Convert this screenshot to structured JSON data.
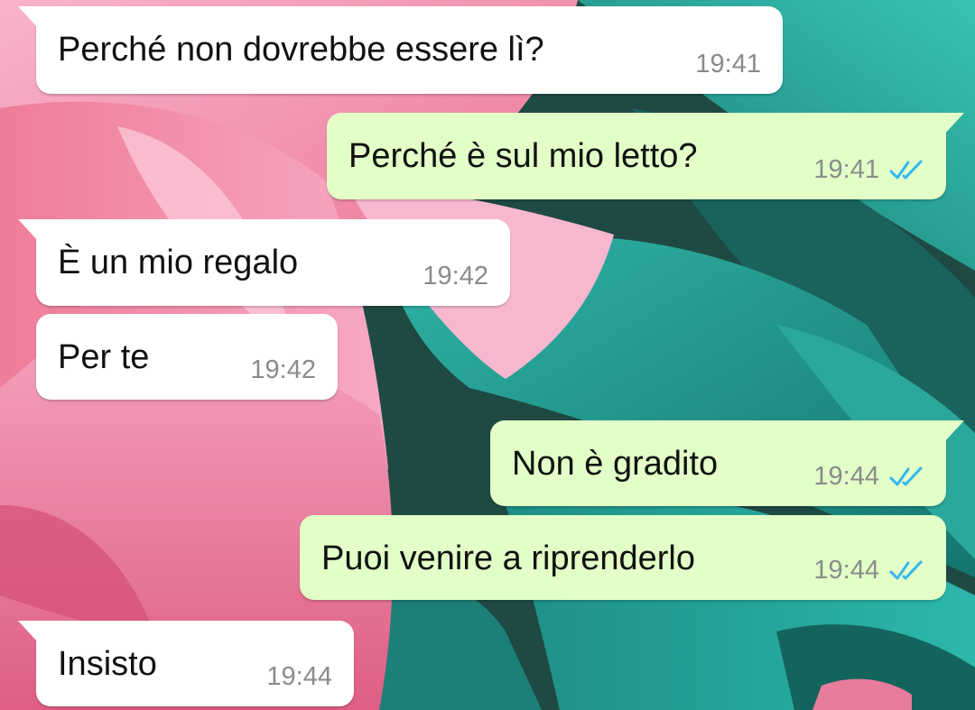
{
  "colors": {
    "incoming_bubble": "#ffffff",
    "outgoing_bubble": "#e2ffc7",
    "timestamp": "#8b8b8b",
    "read_ticks": "#34b7f1"
  },
  "messages": [
    {
      "direction": "incoming",
      "text": "Perché non dovrebbe essere lì?",
      "time": "19:41",
      "status": null
    },
    {
      "direction": "outgoing",
      "text": "Perché è sul mio letto?",
      "time": "19:41",
      "status": "read-ticks-icon"
    },
    {
      "direction": "incoming",
      "text": "È un mio regalo",
      "time": "19:42",
      "status": null
    },
    {
      "direction": "incoming",
      "text": "Per te",
      "time": "19:42",
      "status": null
    },
    {
      "direction": "outgoing",
      "text": "Non è gradito",
      "time": "19:44",
      "status": "read-ticks-icon"
    },
    {
      "direction": "outgoing",
      "text": "Puoi venire a riprenderlo",
      "time": "19:44",
      "status": "read-ticks-icon"
    },
    {
      "direction": "incoming",
      "text": "Insisto",
      "time": "19:44",
      "status": null
    }
  ]
}
